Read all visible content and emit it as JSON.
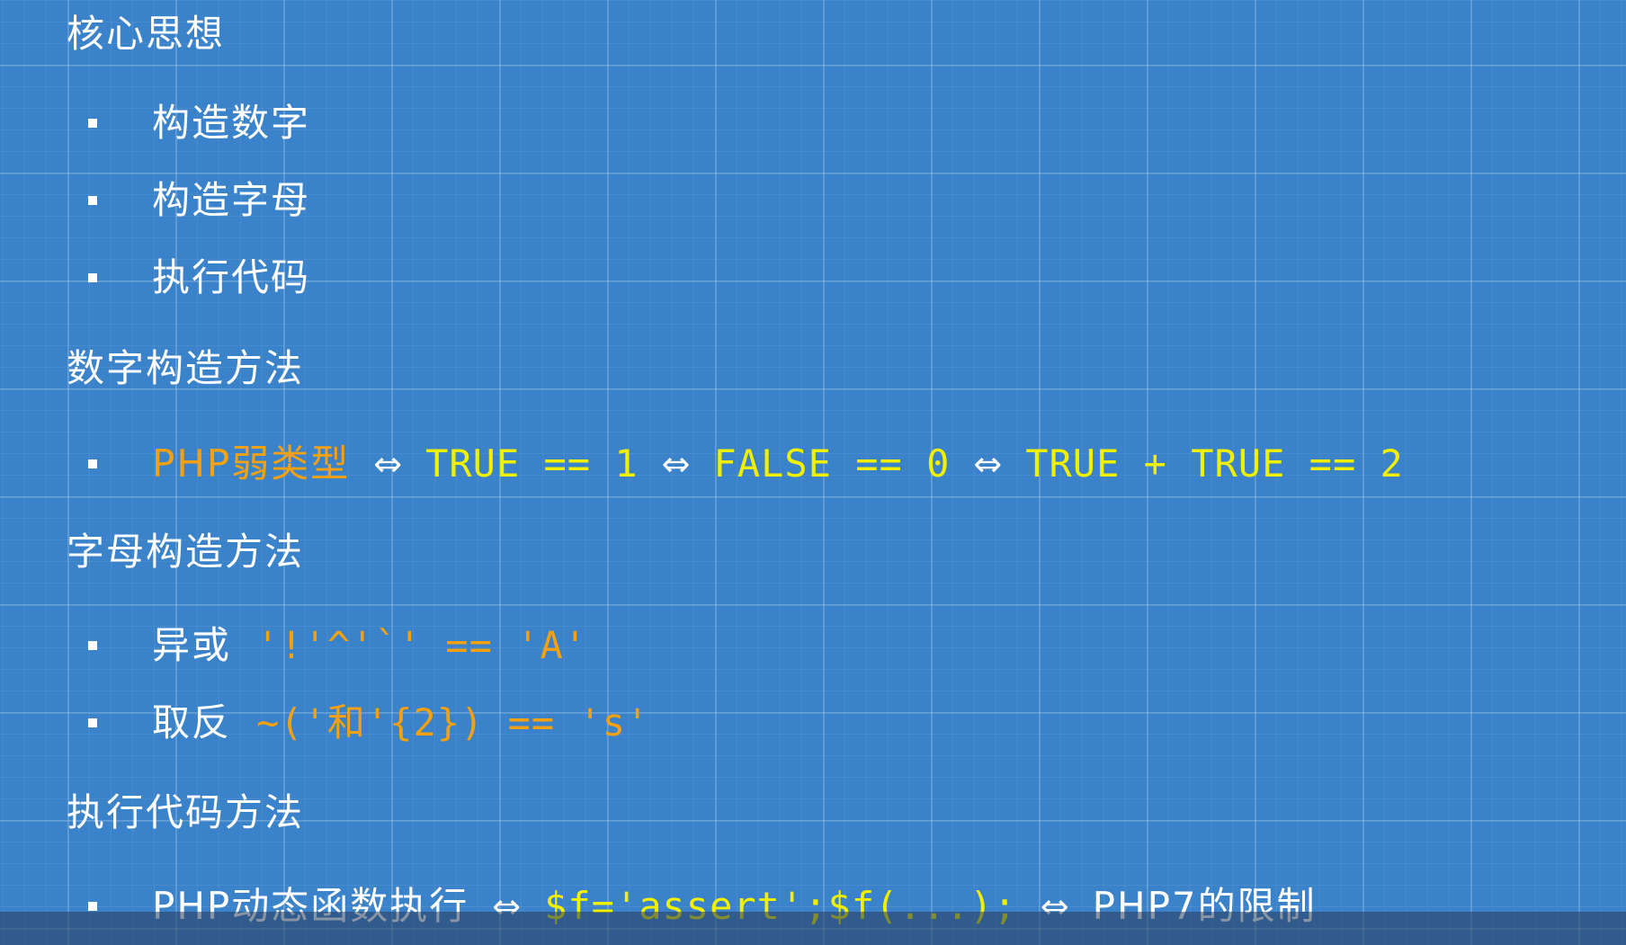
{
  "slide": {
    "headings": {
      "core": "核心思想",
      "number_method": "数字构造方法",
      "letter_method": "字母构造方法",
      "exec_method": "执行代码方法"
    },
    "core_items": [
      "构造数字",
      "构造字母",
      "执行代码"
    ],
    "number_line": {
      "lead": "PHP弱类型",
      "arrow": "⇔",
      "expr1": "TRUE == 1",
      "expr2": "FALSE == 0",
      "expr3": "TRUE + TRUE == 2"
    },
    "letter_items": [
      {
        "label": "异或",
        "code": "'!'^'`' == 'A'"
      },
      {
        "label": "取反",
        "code": "~('和'{2}) == 's'"
      }
    ],
    "exec_line": {
      "lead": "PHP动态函数执行",
      "code": "$f='assert';$f(...);",
      "tail": "PHP7的限制"
    }
  },
  "colors": {
    "background": "#3a82c9",
    "heading_text": "#ffffff",
    "accent_orange": "#f5a10f",
    "accent_yellow": "#f0f000"
  }
}
